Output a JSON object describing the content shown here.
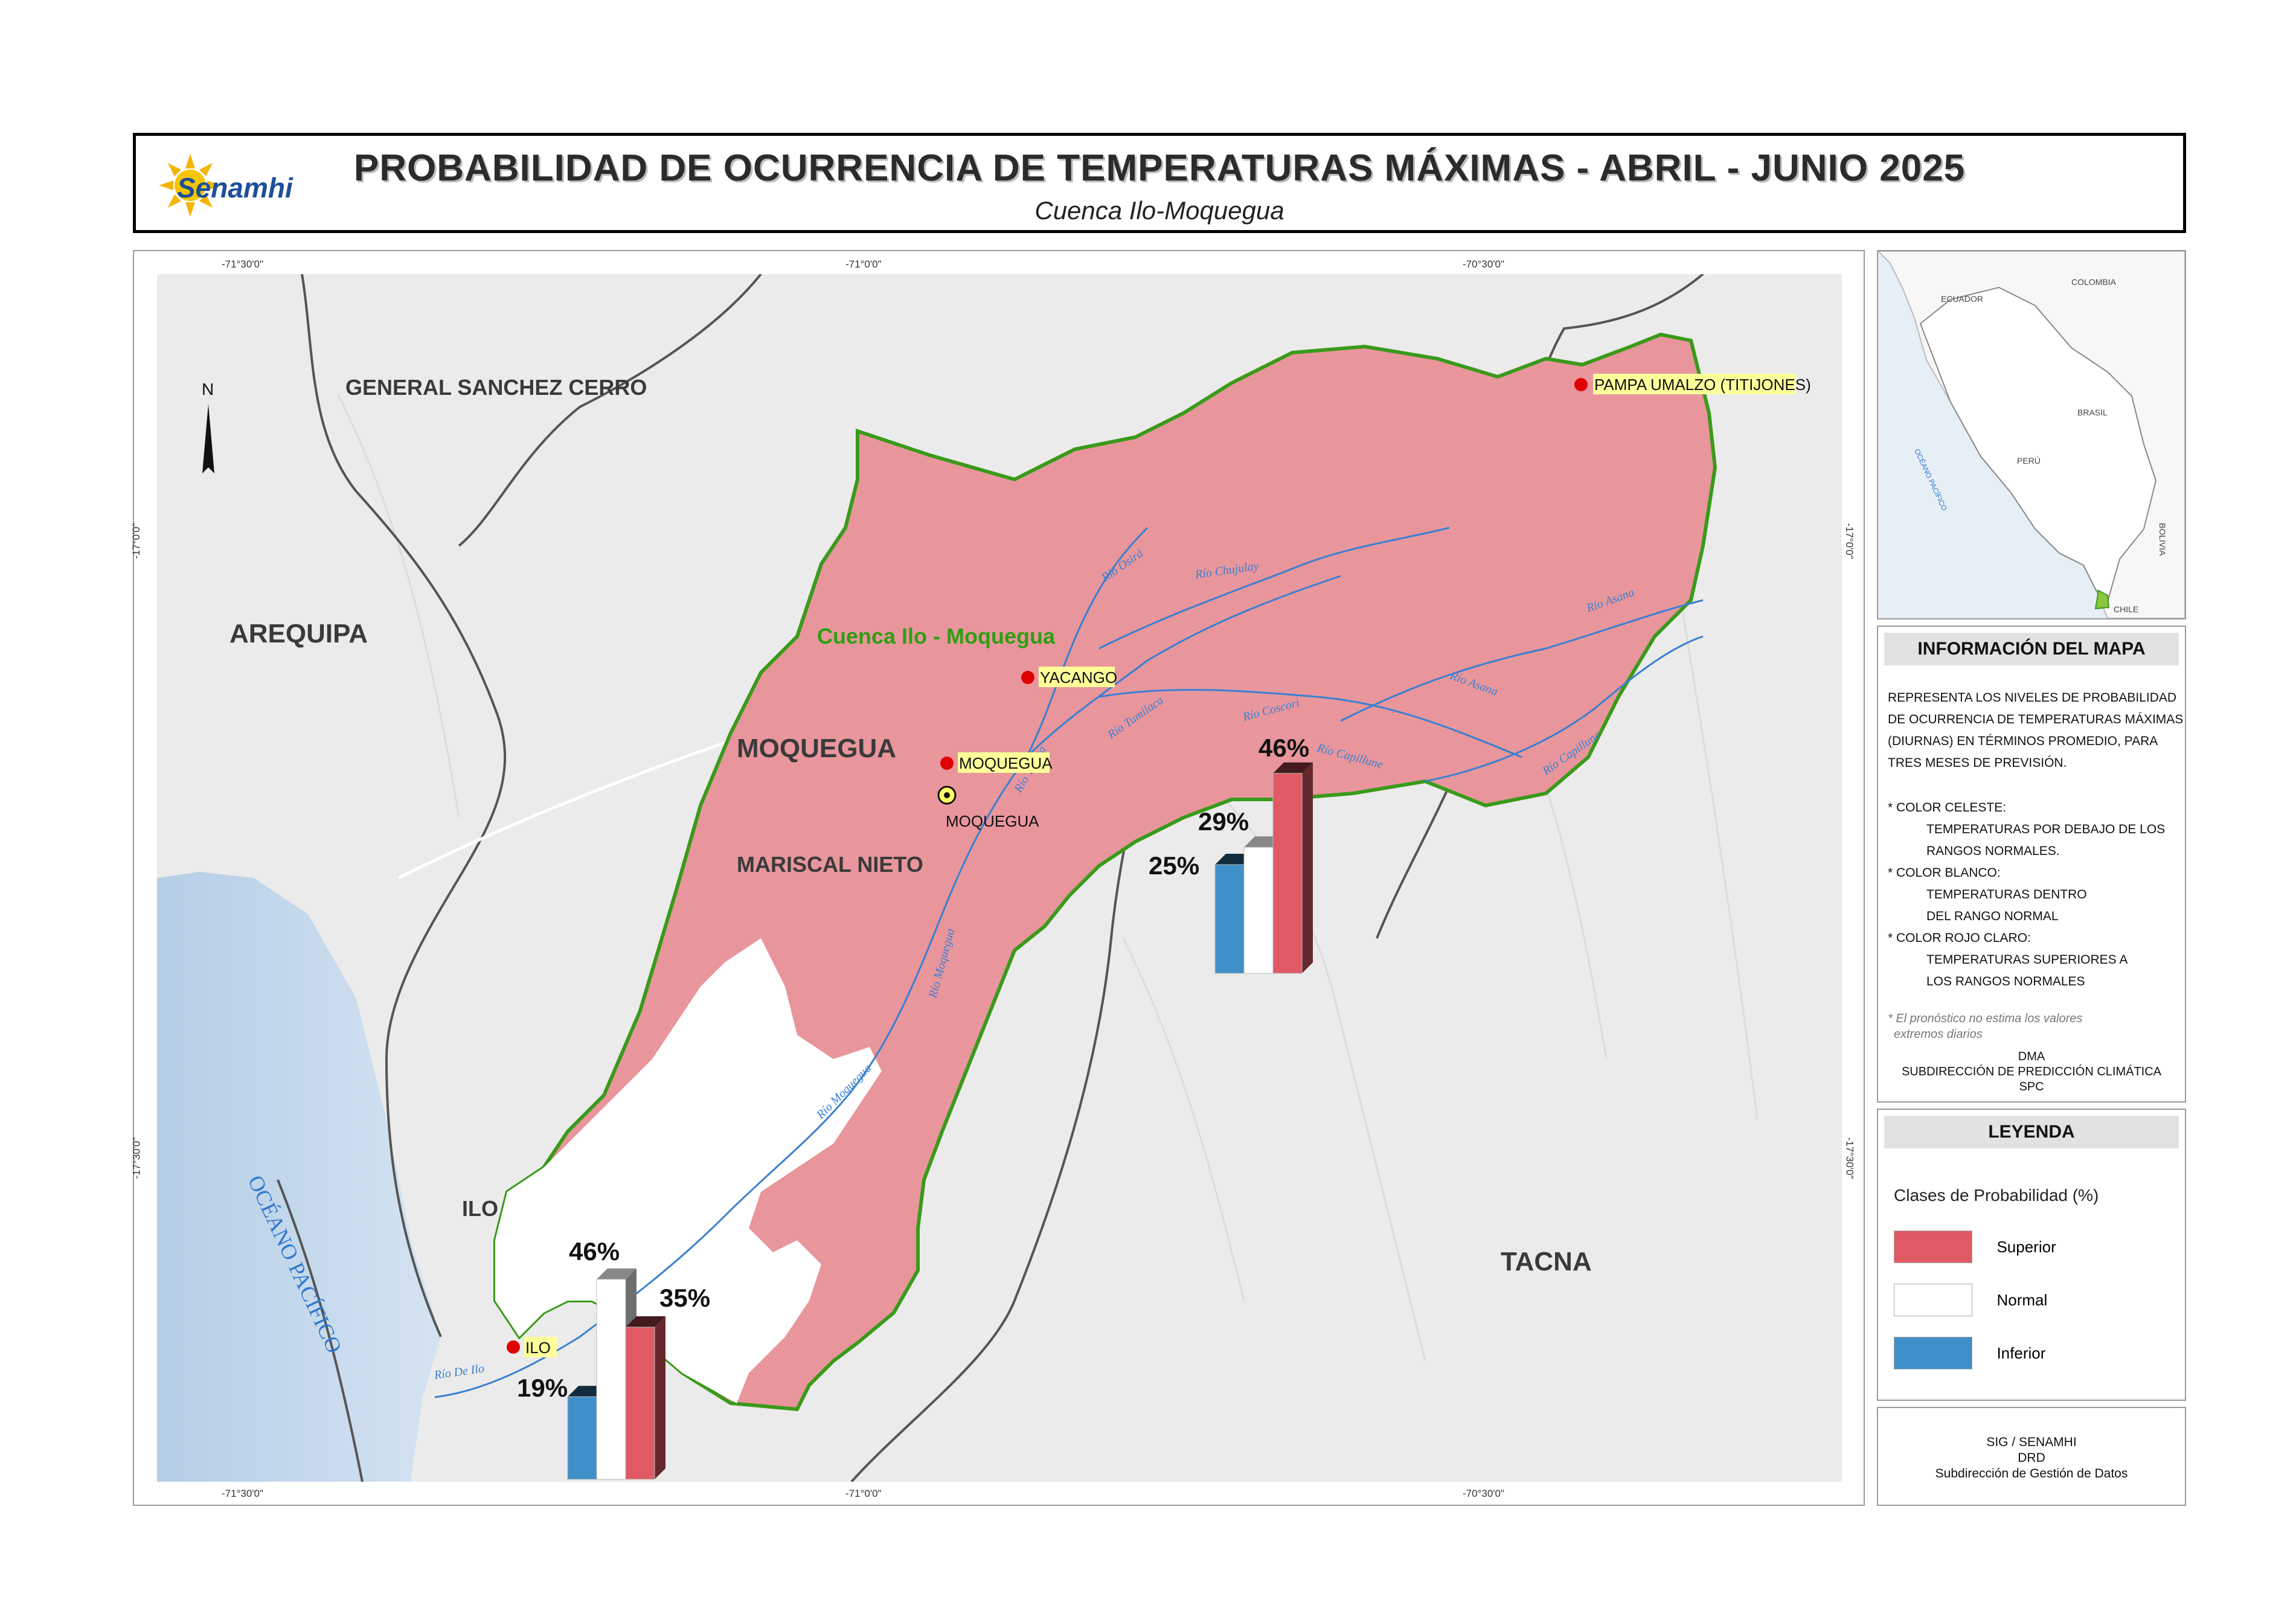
{
  "header": {
    "logo_text": "Senamhi",
    "title": "PROBABILIDAD DE OCURRENCIA DE TEMPERATURAS MÁXIMAS - ABRIL - JUNIO 2025",
    "subtitle": "Cuenca Ilo-Moquegua"
  },
  "map": {
    "coords": {
      "lon_w": "-71°30'0\"",
      "lon_c": "-71°0'0\"",
      "lon_e": "-70°30'0\"",
      "lat_n": "-17°0'0\"",
      "lat_s": "-17°30'0\""
    },
    "north": "N",
    "regions": {
      "general_sanchez_cerro": "GENERAL SANCHEZ CERRO",
      "arequipa": "AREQUIPA",
      "moquegua": "MOQUEGUA",
      "mariscal_nieto": "MARISCAL NIETO",
      "ilo": "ILO",
      "tacna": "TACNA",
      "ocean": "OCÉANO PACÍFICO"
    },
    "basin_label": "Cuenca Ilo - Moquegua",
    "places": {
      "pampa_umalzo": "PAMPA UMALZO (TITIJONES)",
      "yacango": "YACANGO",
      "moquegua_station": "MOQUEGUA",
      "moquegua_city": "MOQUEGUA",
      "ilo": "ILO"
    },
    "rivers": [
      "Río Osirá",
      "Río Chujulay",
      "Río Asana",
      "Río Tumilaca",
      "Río Coscori",
      "Río Capillune",
      "Río Torata",
      "Río Moquegua",
      "Río Moquegua",
      "Río De Ilo",
      "Río Asana",
      "Río Capillune"
    ],
    "bars_upper": {
      "inferior": "25%",
      "normal": "29%",
      "superior": "46%"
    },
    "bars_lower": {
      "inferior": "19%",
      "normal": "46%",
      "superior": "35%"
    },
    "colors": {
      "superior": "#e05a64",
      "normal": "#ffffff",
      "inferior": "#3f8fc8",
      "basin": "#e8969c",
      "basin_border": "#3a9a1a"
    }
  },
  "inset": {
    "labels": {
      "ecuador": "ECUADOR",
      "colombia": "COLOMBIA",
      "brasil": "BRASIL",
      "peru": "PERÚ",
      "bolivia": "BOLIVIA",
      "chile": "CHILE",
      "ocean": "OCÉANO PACÍFICO"
    }
  },
  "info": {
    "heading": "INFORMACIÓN DEL MAPA",
    "lines": [
      "REPRESENTA LOS NIVELES DE PROBABILIDAD",
      "DE OCURRENCIA DE TEMPERATURAS MÁXIMAS",
      "(DIURNAS) EN TÉRMINOS PROMEDIO, PARA",
      "TRES MESES DE PREVISIÓN."
    ],
    "items": [
      {
        "label": "* COLOR CELESTE:",
        "desc1": "TEMPERATURAS POR DEBAJO DE LOS",
        "desc2": "RANGOS NORMALES."
      },
      {
        "label": "* COLOR BLANCO:",
        "desc1": "TEMPERATURAS DENTRO",
        "desc2": "DEL RANGO NORMAL"
      },
      {
        "label": "* COLOR ROJO CLARO:",
        "desc1": "TEMPERATURAS SUPERIORES A",
        "desc2": "LOS RANGOS NORMALES"
      }
    ],
    "note1": "* El pronóstico no estima los valores",
    "note2": "extremos diarios",
    "credit1": "DMA",
    "credit2": "SUBDIRECCIÓN DE PREDICCIÓN CLIMÁTICA",
    "credit3": "SPC"
  },
  "legend": {
    "heading": "LEYENDA",
    "subtitle": "Clases de Probabilidad (%)",
    "items": [
      {
        "label": "Superior",
        "color": "#e05a64"
      },
      {
        "label": "Normal",
        "color": "#ffffff"
      },
      {
        "label": "Inferior",
        "color": "#3f8fc8"
      }
    ]
  },
  "footer": {
    "line1": "SIG / SENAMHI",
    "line2": "DRD",
    "line3": "Subdirección de Gestión de Datos"
  }
}
